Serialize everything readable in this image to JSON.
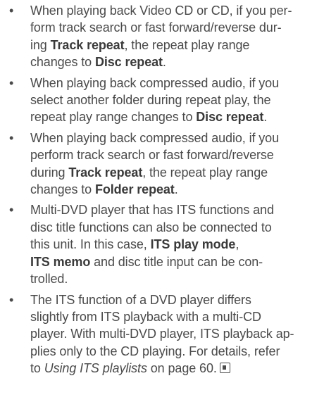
{
  "items": [
    {
      "lines": [
        [
          {
            "t": "When playing back Video CD or CD, if you per-"
          }
        ],
        [
          {
            "t": "form track search or fast forward/reverse dur-"
          }
        ],
        [
          {
            "t": "ing "
          },
          {
            "t": "Track repeat",
            "b": true
          },
          {
            "t": ", the repeat play range"
          }
        ],
        [
          {
            "t": "changes to "
          },
          {
            "t": "Disc repeat",
            "b": true
          },
          {
            "t": "."
          }
        ]
      ]
    },
    {
      "lines": [
        [
          {
            "t": "When playing back compressed audio, if you"
          }
        ],
        [
          {
            "t": "select another folder during repeat play, the"
          }
        ],
        [
          {
            "t": "repeat play range changes to "
          },
          {
            "t": "Disc repeat",
            "b": true
          },
          {
            "t": "."
          }
        ]
      ]
    },
    {
      "lines": [
        [
          {
            "t": "When playing back compressed audio, if you"
          }
        ],
        [
          {
            "t": "perform track search or fast forward/reverse"
          }
        ],
        [
          {
            "t": "during "
          },
          {
            "t": "Track repeat",
            "b": true
          },
          {
            "t": ", the repeat play range"
          }
        ],
        [
          {
            "t": "changes to "
          },
          {
            "t": "Folder repeat",
            "b": true
          },
          {
            "t": "."
          }
        ]
      ]
    },
    {
      "lines": [
        [
          {
            "t": "Multi-DVD player that has ITS functions and"
          }
        ],
        [
          {
            "t": "disc title functions can also be connected to"
          }
        ],
        [
          {
            "t": "this unit. In this case, "
          },
          {
            "t": "ITS play mode",
            "b": true
          },
          {
            "t": ","
          }
        ],
        [
          {
            "t": "ITS memo",
            "b": true
          },
          {
            "t": " and disc title input can be con-"
          }
        ],
        [
          {
            "t": "trolled."
          }
        ]
      ]
    },
    {
      "lines": [
        [
          {
            "t": "The ITS function of a DVD player differs"
          }
        ],
        [
          {
            "t": "slightly from ITS playback with a multi-CD"
          }
        ],
        [
          {
            "t": "player. With multi-DVD player, ITS playback ap-"
          }
        ],
        [
          {
            "t": "plies only to the CD playing. For details, refer"
          }
        ],
        [
          {
            "t": "to "
          },
          {
            "t": "Using ITS playlists",
            "i": true
          },
          {
            "t": " on page 60."
          }
        ]
      ],
      "end_mark": true
    }
  ],
  "bullet_char": "•"
}
